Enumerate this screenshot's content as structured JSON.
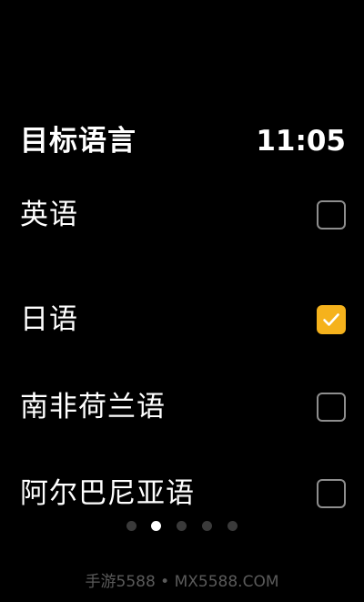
{
  "header": {
    "title": "目标语言",
    "time": "11:05"
  },
  "languages": [
    {
      "label": "英语",
      "checked": false
    },
    {
      "label": "日语",
      "checked": true
    },
    {
      "label": "南非荷兰语",
      "checked": false
    },
    {
      "label": "阿尔巴尼亚语",
      "checked": false
    }
  ],
  "pager": {
    "page_count": 5,
    "active_page": 2
  },
  "watermark": {
    "text": "手游5588 • MX5588.COM"
  },
  "colors": {
    "background": "#000000",
    "accent": "#f5b21c",
    "checkbox_border": "#8e8e8e",
    "dot_inactive": "#3a3a3a",
    "dot_active": "#ffffff"
  }
}
